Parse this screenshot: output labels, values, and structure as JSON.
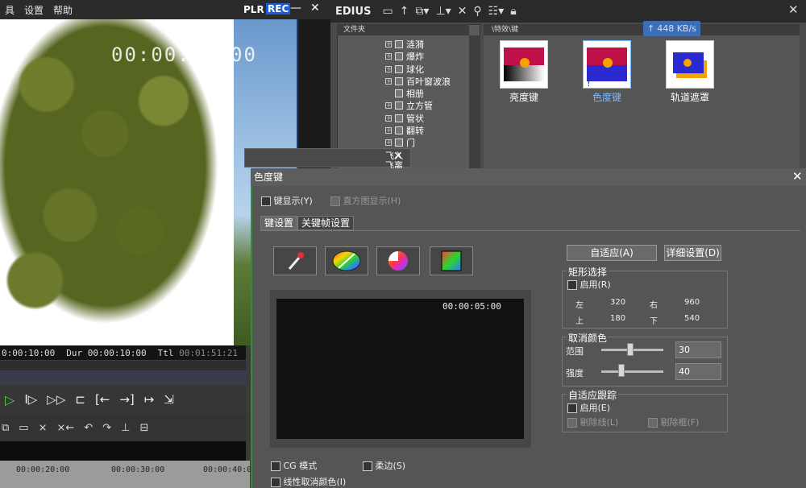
{
  "player": {
    "menu": [
      "具",
      "设置",
      "帮助"
    ],
    "plr_label": "PLR",
    "rec_label": "REC",
    "timecode_overlay": "00:00:05:00",
    "timecodes": {
      "in_value": "0:00:10:00",
      "dur_label": "Dur",
      "dur_value": "00:00:10:00",
      "ttl_label": "Ttl",
      "ttl_value": "00:01:51:21"
    },
    "ruler_ticks": [
      "00:00:20:00",
      "00:00:30:00",
      "00:00:40:0"
    ]
  },
  "bin": {
    "app_name": "EDIUS",
    "folder_header": "文件夹",
    "clip_header": "\\特效\\键",
    "speed": "448 KB/s",
    "tree_items": [
      "涟漪",
      "爆炸",
      "球化",
      "百叶窗波浪",
      "相册",
      "立方管",
      "管状",
      "翻转",
      "门",
      "飞入",
      "飞离"
    ],
    "clips": [
      {
        "label": "亮度键",
        "selected": false
      },
      {
        "label": "色度键",
        "selected": true
      },
      {
        "label": "轨道遮罩",
        "selected": false
      }
    ]
  },
  "dialog": {
    "title": "色度键",
    "key_display": "键显示(Y)",
    "histogram_display": "直方图显示(H)",
    "tabs": [
      "键设置",
      "关键帧设置"
    ],
    "preview_timecode": "00:00:05:00",
    "auto_adjust_button": "自适应(A)",
    "detail_settings_button": "详细设置(D)",
    "rect_group": {
      "title": "矩形选择",
      "enable": "启用(R)",
      "left_label": "左",
      "left_value": "320",
      "right_label": "右",
      "right_value": "960",
      "top_label": "上",
      "top_value": "180",
      "bottom_label": "下",
      "bottom_value": "540"
    },
    "cancel_color_group": {
      "title": "取消颜色",
      "range_label": "范围",
      "range_value": "30",
      "strength_label": "强度",
      "strength_value": "40"
    },
    "adaptive_group": {
      "title": "自适应跟踪",
      "enable": "启用(E)",
      "remove_lines": "剔除线(L)",
      "remove_frame": "剔除框(F)"
    },
    "cg_mode": "CG 模式",
    "soft_edge": "柔边(S)",
    "linear_cancel": "线性取消颜色(I)"
  },
  "colors": {
    "rec_badge": "#1e5bd6",
    "play_green": "#4fd14f",
    "speed_badge": "#3c6fb5",
    "dialog_border": "#3a8a3a",
    "selected_clip_text": "#7ab8ff"
  }
}
